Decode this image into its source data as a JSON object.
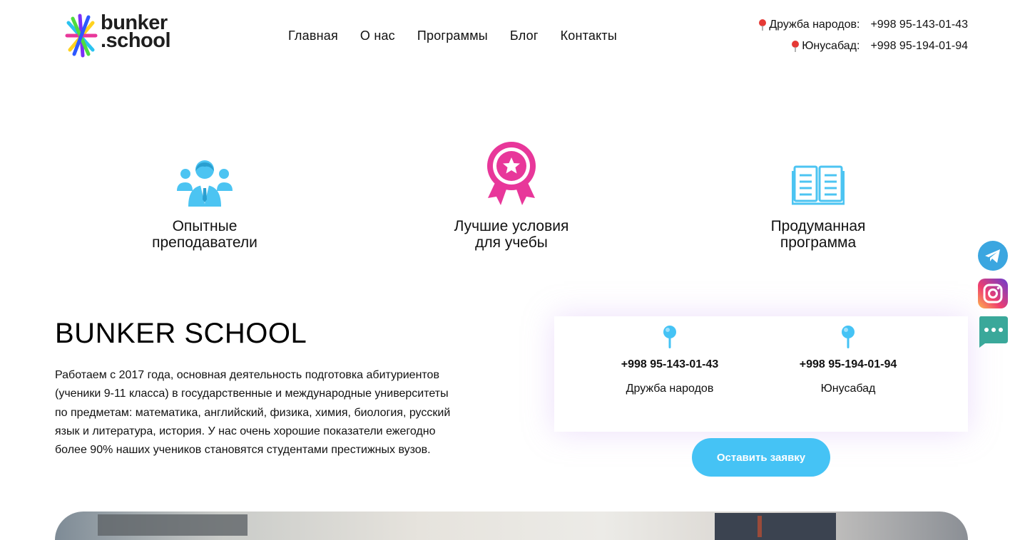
{
  "header": {
    "logo_line1": "bunker",
    "logo_line2": ".school",
    "nav": [
      "Главная",
      "О нас",
      "Программы",
      "Блог",
      "Контакты"
    ],
    "contacts": [
      {
        "location": "Дружба народов:",
        "phone": "+998 95-143-01-43"
      },
      {
        "location": "Юнусабад:",
        "phone": "+998 95-194-01-94"
      }
    ]
  },
  "features": [
    {
      "icon": "teacher-icon",
      "title": "Опытные\nпреподаватели"
    },
    {
      "icon": "award-ribbon-icon",
      "title": "Лучшие условия\nдля учебы"
    },
    {
      "icon": "open-book-icon",
      "title": "Продуманная\nпрограмма"
    }
  ],
  "about": {
    "title": "BUNKER SCHOOL",
    "text": "Работаем с 2017 года, основная деятельность подготовка абитуриентов (ученики 9-11 класса) в государственные и международные университеты по предметам: математика, английский, физика, химия, биология, русский язык и литература, история. У нас очень хорошие показатели ежегодно более 90% наших учеников становятся студентами престижных вузов."
  },
  "card": {
    "branches": [
      {
        "phone": "+998 95-143-01-43",
        "place": "Дружба народов"
      },
      {
        "phone": "+998 95-194-01-94",
        "place": "Юнусабад"
      }
    ]
  },
  "cta_label": "Оставить заявку",
  "socials": [
    "telegram-icon",
    "instagram-icon",
    "chat-icon"
  ],
  "colors": {
    "accent": "#45c3f5",
    "pink": "#e8379a",
    "text": "#111111"
  }
}
